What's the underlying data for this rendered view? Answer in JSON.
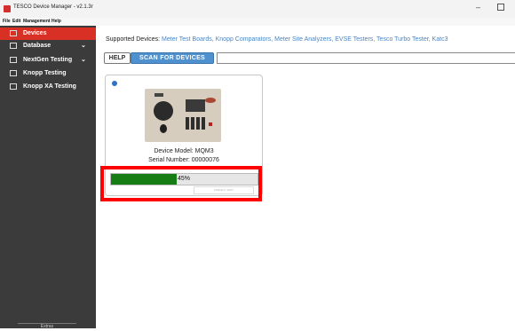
{
  "window": {
    "title": "TESCO Device Manager - v2.1.3r",
    "minimize": "–"
  },
  "menu": [
    "File",
    "Edit",
    "Management",
    "Help"
  ],
  "sidebar": {
    "items": [
      {
        "label": "Devices",
        "icon": "devices-icon",
        "active": true
      },
      {
        "label": "Database",
        "icon": "database-icon",
        "chevron": "⌄"
      },
      {
        "label": "NextGen Testing",
        "icon": "nextgen-icon",
        "chevron": "⌄"
      },
      {
        "label": "Knopp Testing",
        "icon": "knopp-icon"
      },
      {
        "label": "Knopp XA Testing",
        "icon": "knopp-xa-icon"
      }
    ],
    "extras_label": "Extras"
  },
  "main": {
    "supported_prefix": "Supported Devices:",
    "supported_list": "Meter Test Boards, Knopp Comparators, Meter Site Analyzers, EVSE Testers, Tesco Turbo Tester, Katc3",
    "help_button": "HELP",
    "scan_button": "SCAN FOR DEVICES",
    "search_value": ""
  },
  "device_card": {
    "model_line": "Device Model: MQM3",
    "serial_line": "Serial Number: 00000076",
    "progress_percent": 45,
    "progress_text": "45%",
    "disabled_button": "FORCE F. WAIT"
  },
  "colors": {
    "sidebar_bg": "#3b3b3b",
    "active_nav": "#d93025",
    "scan_button": "#4f90cf",
    "progress": "#167d14",
    "highlight": "#ff0000"
  }
}
